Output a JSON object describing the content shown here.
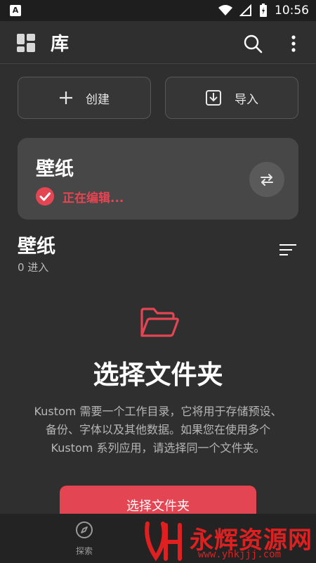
{
  "statusbar": {
    "time": "10:56",
    "left_icon_text": "A"
  },
  "appbar": {
    "title": "库"
  },
  "actions": {
    "create_label": "创建",
    "import_label": "导入"
  },
  "card": {
    "title": "壁纸",
    "status": "正在编辑..."
  },
  "section": {
    "title": "壁纸",
    "count": "0 进入"
  },
  "empty": {
    "title": "选择文件夹",
    "description": "Kustom 需要一个工作目录，它将用于存储预设、备份、字体以及其他数据。如果您在使用多个 Kustom 系列应用，请选择同一个文件夹。",
    "button_label": "选择文件夹"
  },
  "bottomnav": {
    "explore_label": "探索"
  },
  "watermark": {
    "text": "永辉资源网",
    "url": "www.yhkjjj.com"
  },
  "colors": {
    "accent": "#e34552",
    "background": "#2f2f2f",
    "card": "#474747"
  }
}
